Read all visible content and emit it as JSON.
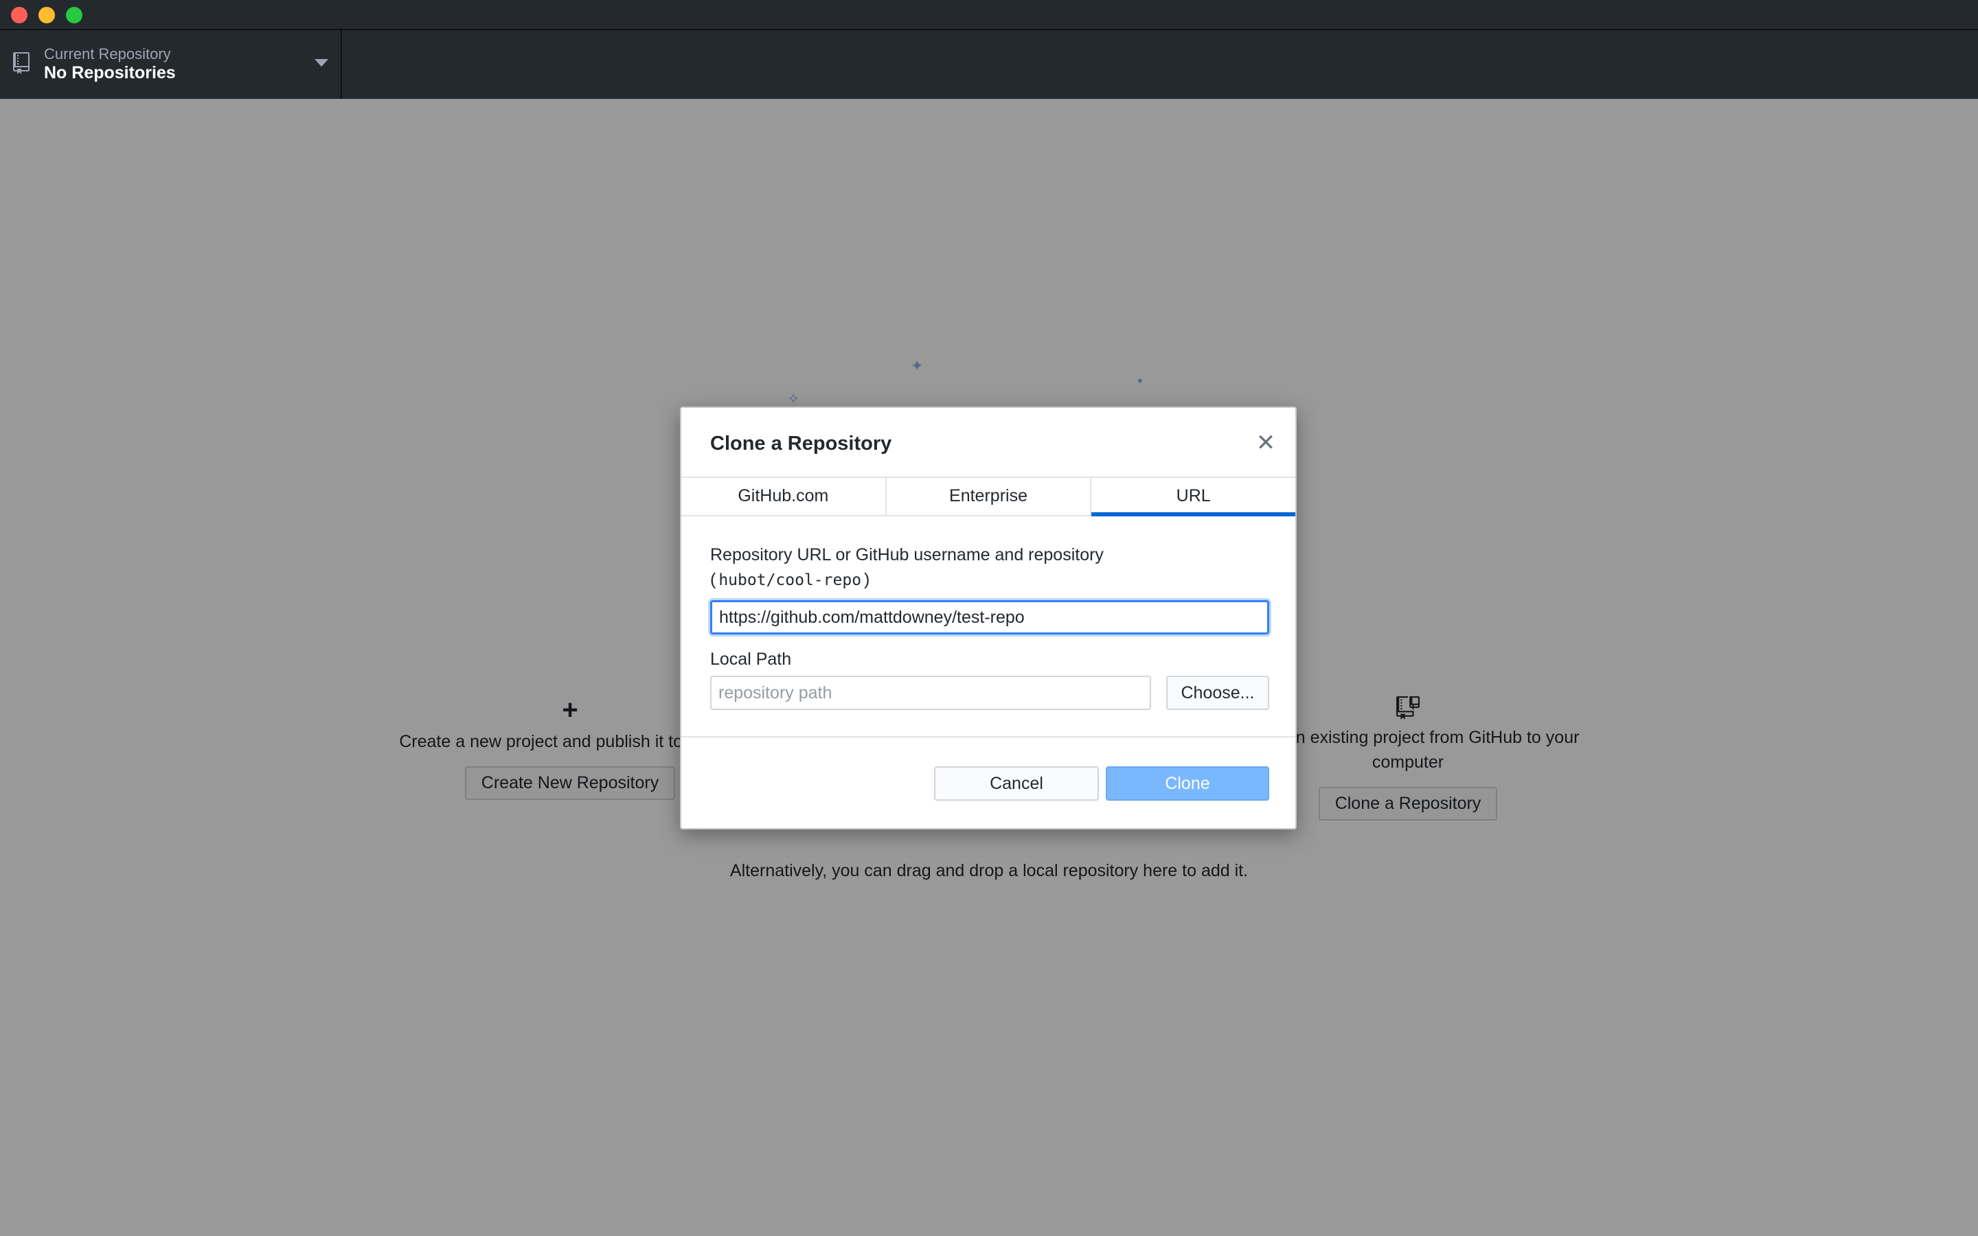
{
  "header": {
    "repo_caption": "Current Repository",
    "repo_name": "No Repositories"
  },
  "blank_slate": {
    "create": {
      "description": "Create a new project and publish it to GitHub",
      "button": "Create New Repository"
    },
    "clone": {
      "description": "Clone an existing project from GitHub to your computer",
      "button": "Clone a Repository"
    },
    "drop_hint": "Alternatively, you can drag and drop a local repository here to add it."
  },
  "dialog": {
    "title": "Clone a Repository",
    "close_symbol": "✕",
    "tabs": [
      {
        "label": "GitHub.com",
        "selected": false
      },
      {
        "label": "Enterprise",
        "selected": false
      },
      {
        "label": "URL",
        "selected": true
      }
    ],
    "url_label": "Repository URL or GitHub username and repository",
    "url_hint_open": "(",
    "url_hint_code": "hubot/cool-repo",
    "url_hint_close": ")",
    "url_value": "https://github.com/mattdowney/test-repo",
    "local_path_label": "Local Path",
    "local_path_placeholder": "repository path",
    "local_path_value": "",
    "choose_button": "Choose...",
    "cancel_button": "Cancel",
    "clone_button": "Clone"
  },
  "icons": {
    "repo": "repo-icon",
    "caret": "caret-down-icon",
    "plus": "plus-icon",
    "clone": "repo-clone-icon",
    "close": "close-icon"
  },
  "colors": {
    "toolbar_bg": "#24292e",
    "accent": "#0366d6",
    "clone_button_bg": "#79b8ff",
    "overlay": "rgba(0,0,0,0.4)"
  }
}
